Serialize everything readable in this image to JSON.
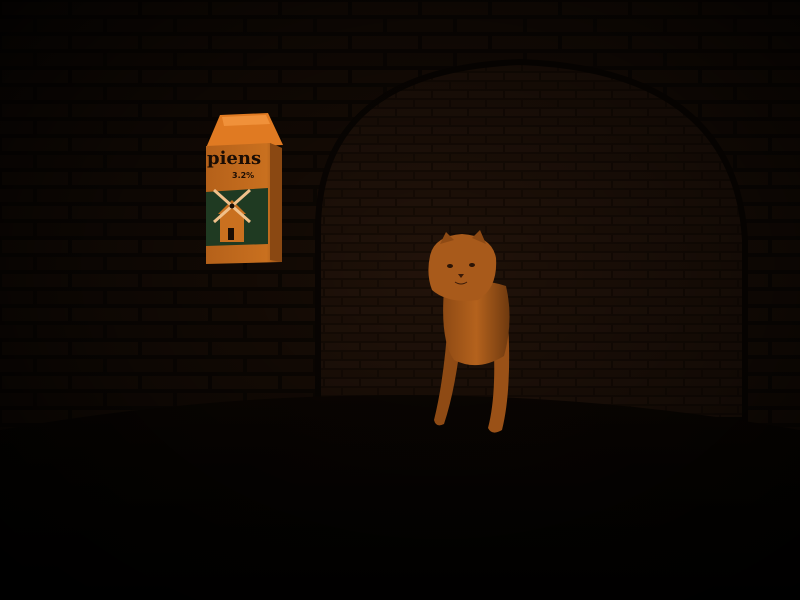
{
  "scene": {
    "setting": "brick-tunnel",
    "colors": {
      "darkness": "#070300",
      "brick": "#1e1006",
      "mortar": "#0c0602",
      "carton": "#c46a1a",
      "carton_top": "#e07a22",
      "carton_green": "#1f3a22",
      "cat_fur": "#b0601c"
    }
  },
  "milk_carton": {
    "brand": "piens",
    "badge": "3.2%",
    "icon": "windmill-icon"
  },
  "creature": {
    "type": "cat",
    "icon": "cat-face-icon"
  }
}
